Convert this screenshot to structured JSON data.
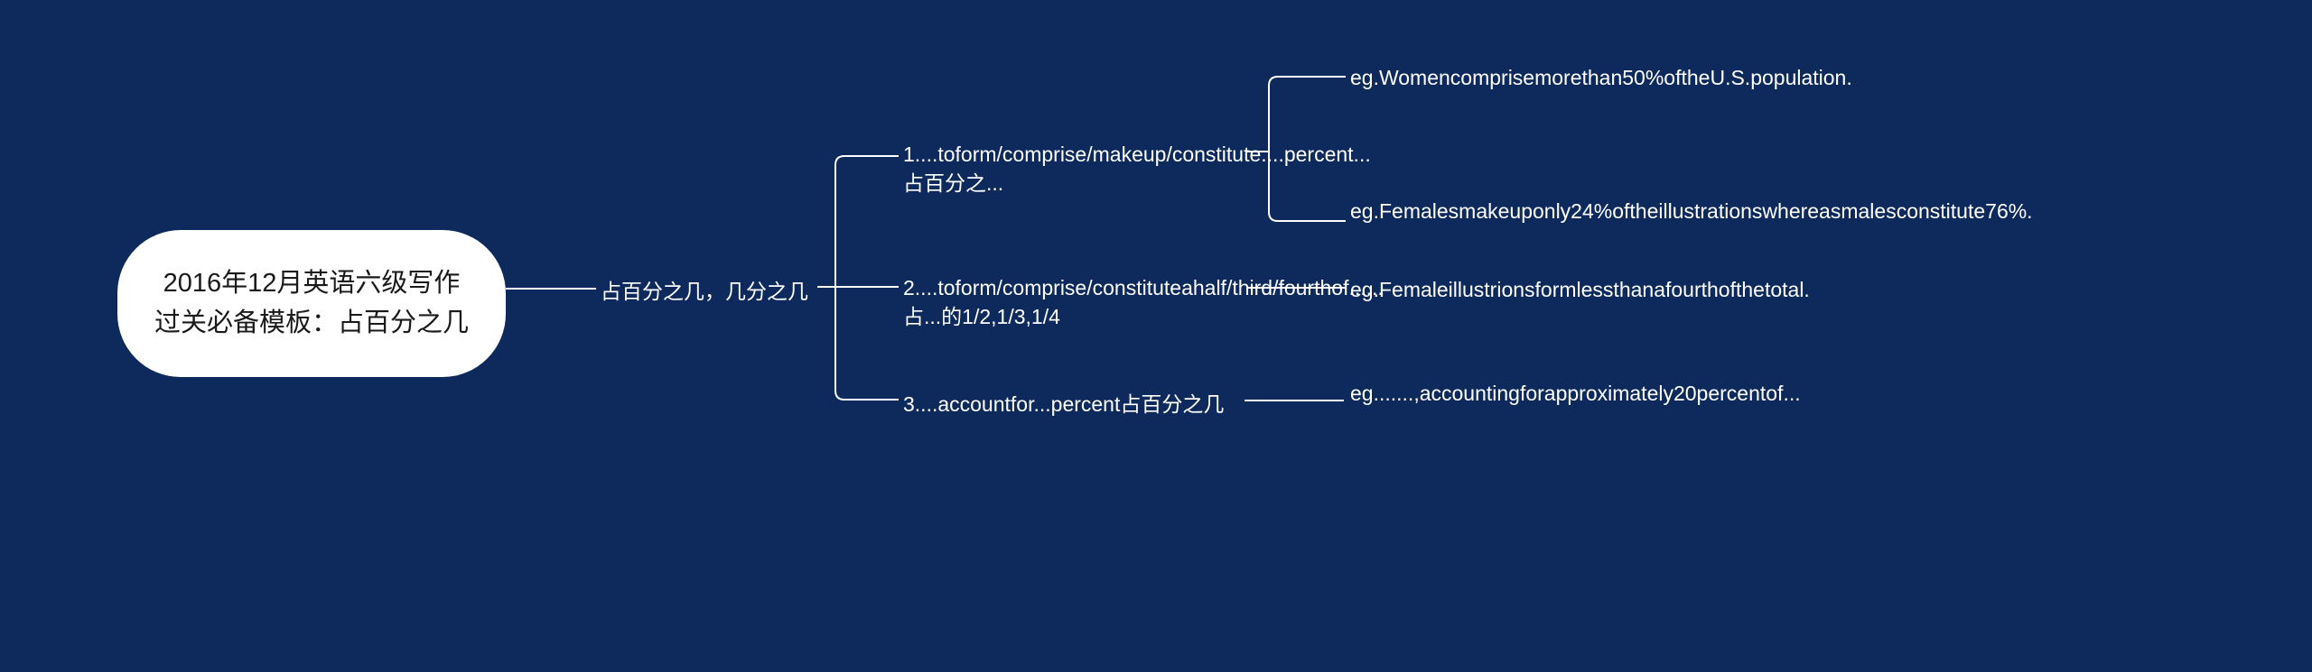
{
  "root": {
    "title": "2016年12月英语六级写作过关必备模板：占百分之几"
  },
  "level1": {
    "label": "占百分之几，几分之几"
  },
  "level2": {
    "item1": "1....toform/comprise/makeup/constitute....percent...占百分之...",
    "item2": "2....toform/comprise/constituteahalf/third/fourthof......占...的1/2,1/3,1/4",
    "item3": "3....accountfor...percent占百分之几"
  },
  "level3": {
    "item1a": "eg.Womencomprisemorethan50%oftheU.S.population.",
    "item1b": "eg.Femalesmakeuponly24%oftheillustrationswhereasmalesconstitute76%.",
    "item2": "eg.Femaleillustrionsformlessthanafourthofthetotal.",
    "item3": "eg.......,accountingforapproximately20percentof..."
  }
}
